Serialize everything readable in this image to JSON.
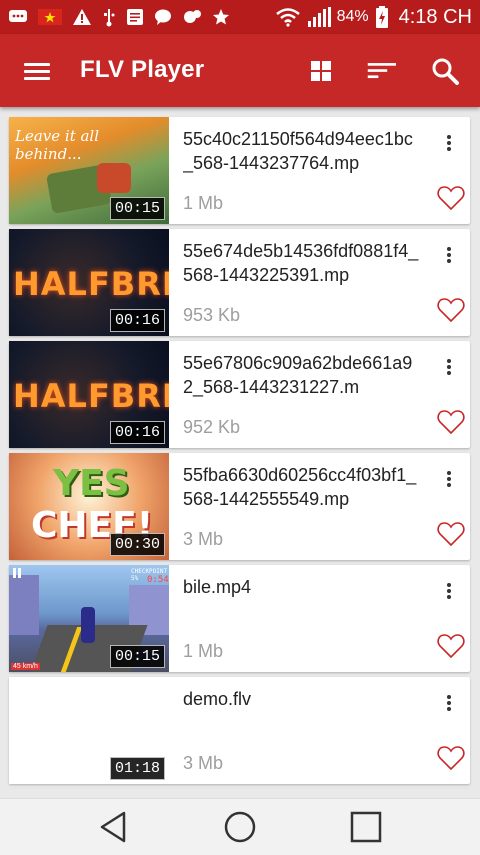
{
  "status_bar": {
    "battery_percent": "84%",
    "time": "4:18 CH"
  },
  "app_bar": {
    "title": "FLV Player"
  },
  "videos": [
    {
      "name": "55c40c21150f564d94eec1bc_568-1443237764.mp",
      "size": "1 Mb",
      "duration": "00:15",
      "thumb_text": "Leave it all behind..."
    },
    {
      "name": "55e674de5b14536fdf0881f4_568-1443225391.mp",
      "size": "953 Kb",
      "duration": "00:16",
      "thumb_text": "HALFBRIC"
    },
    {
      "name": "55e67806c909a62bde661a92_568-1443231227.m",
      "size": "952 Kb",
      "duration": "00:16",
      "thumb_text": "HALFBRIC"
    },
    {
      "name": "55fba6630d60256cc4f03bf1_568-1442555549.mp",
      "size": "3 Mb",
      "duration": "00:30",
      "thumb_text_1": "YES",
      "thumb_text_2": "CHEF!"
    },
    {
      "name": "bile.mp4",
      "size": "1 Mb",
      "duration": "00:15",
      "thumb_text_1": "CHECKPOINT 5%",
      "thumb_text_2": "0:54:16",
      "thumb_text_3": "45 km/h"
    },
    {
      "name": "demo.flv",
      "size": "3 Mb",
      "duration": "01:18"
    }
  ],
  "colors": {
    "status_bar": "#b71c1c",
    "app_bar": "#c62828",
    "heart": "#c62828",
    "background": "#e9e9e9"
  },
  "icons": {
    "menu": "hamburger-menu-icon",
    "grid": "grid-view-icon",
    "sort": "sort-icon",
    "search": "search-icon",
    "more": "more-vertical-icon",
    "favorite": "heart-outline-icon",
    "back": "nav-back-icon",
    "home": "nav-home-icon",
    "recents": "nav-recents-icon"
  }
}
